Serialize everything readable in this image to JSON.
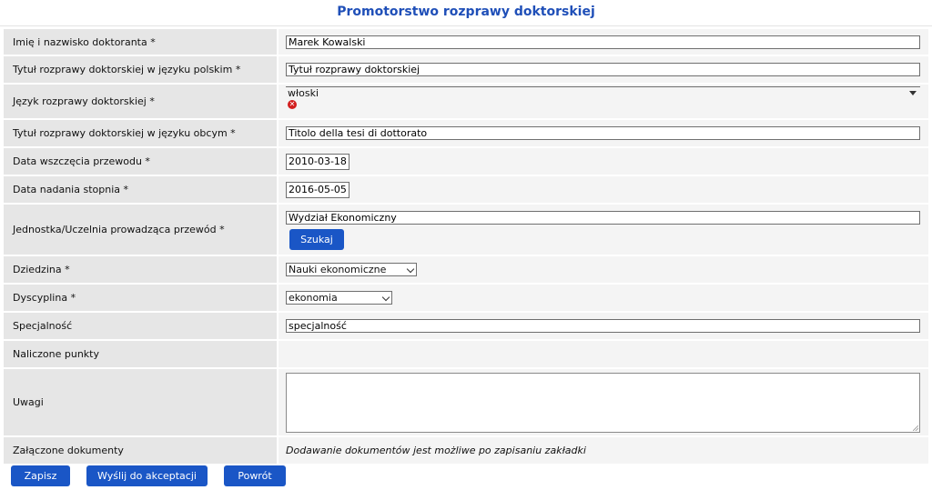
{
  "page": {
    "title": "Promotorstwo rozprawy doktorskiej"
  },
  "fields": {
    "name": {
      "label": "Imię i nazwisko doktoranta *",
      "value": "Marek Kowalski"
    },
    "title_pl": {
      "label": "Tytuł rozprawy doktorskiej w języku polskim *",
      "value": "Tytuł rozprawy doktorskiej"
    },
    "language": {
      "label": "Język rozprawy doktorskiej *",
      "value": "włoski",
      "error_icon": "error-x-icon"
    },
    "title_foreign": {
      "label": "Tytuł rozprawy doktorskiej w języku obcym *",
      "value": "Titolo della tesi di dottorato"
    },
    "start_date": {
      "label": "Data wszczęcia przewodu *",
      "value": "2010-03-18"
    },
    "degree_date": {
      "label": "Data nadania stopnia *",
      "value": "2016-05-05"
    },
    "unit": {
      "label": "Jednostka/Uczelnia prowadząca przewód *",
      "value": "Wydział Ekonomiczny",
      "button": "Szukaj"
    },
    "domain": {
      "label": "Dziedzina *",
      "value": "Nauki ekonomiczne"
    },
    "discipline": {
      "label": "Dyscyplina *",
      "value": "ekonomia"
    },
    "specialty": {
      "label": "Specjalność",
      "value": "specjalność"
    },
    "points": {
      "label": "Naliczone punkty",
      "value": ""
    },
    "notes": {
      "label": "Uwagi",
      "value": ""
    },
    "attachments": {
      "label": "Załączone dokumenty",
      "value": "Dodawanie dokumentów jest możliwe po zapisaniu zakładki"
    }
  },
  "footer": {
    "save": "Zapisz",
    "send": "Wyślij do akceptacji",
    "back": "Powrót"
  },
  "colors": {
    "title": "#1f4fb8",
    "button": "#1a56c6",
    "error": "#d21e1e"
  }
}
